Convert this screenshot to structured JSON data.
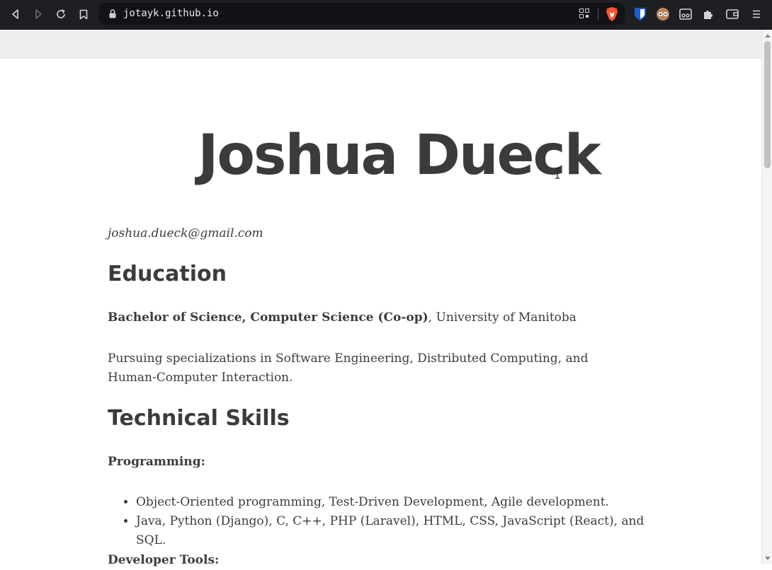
{
  "browser": {
    "url": "jotayk.github.io",
    "icons": {
      "back": "back-icon",
      "forward": "forward-icon",
      "reload": "reload-icon",
      "bookmark": "bookmark-icon",
      "lock": "lock-icon",
      "qr": "qr-code-icon",
      "brave": "brave-shields-icon",
      "bitwarden": "bitwarden-icon",
      "privacy": "privacy-extension-icon",
      "reader": "reader-icon",
      "extensions": "extensions-icon",
      "wallet": "wallet-icon",
      "menu": "menu-icon"
    },
    "colors": {
      "chrome": "#1e1f22",
      "urlbar": "#121316",
      "brave": "#fb542b",
      "bitwarden": "#175ddc"
    }
  },
  "resume": {
    "name": "Joshua Dueck",
    "email": "joshua.dueck@gmail.com",
    "education": {
      "heading": "Education",
      "degree": "Bachelor of Science, Computer Science (Co-op)",
      "school": ", University of Manitoba",
      "specializations": "Pursuing specializations in Software Engineering, Distributed Computing, and Human-Computer Interaction."
    },
    "skills": {
      "heading": "Technical Skills",
      "programming_label": "Programming:",
      "programming_items": [
        "Object-Oriented programming, Test-Driven Development, Agile development.",
        "Java, Python (Django), C, C++, PHP (Laravel), HTML, CSS, JavaScript (React), and SQL."
      ],
      "tools_label": "Developer Tools:"
    }
  }
}
